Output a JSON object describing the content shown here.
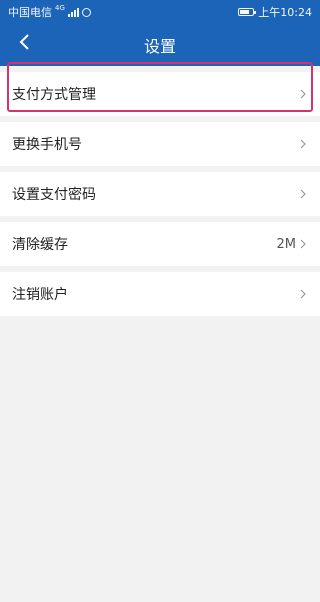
{
  "status_bar": {
    "carrier": "中国电信",
    "network": "4G",
    "time": "上午10:24"
  },
  "header": {
    "title": "设置",
    "back_icon": "chevron-left-icon"
  },
  "settings": [
    {
      "label": "支付方式管理",
      "value": ""
    },
    {
      "label": "更换手机号",
      "value": ""
    },
    {
      "label": "设置支付密码",
      "value": ""
    },
    {
      "label": "清除缓存",
      "value": "2M"
    },
    {
      "label": "注销账户",
      "value": ""
    }
  ],
  "colors": {
    "header_bg": "#1b64b8",
    "highlight": "#d9306e",
    "page_bg": "#f2f2f2"
  }
}
